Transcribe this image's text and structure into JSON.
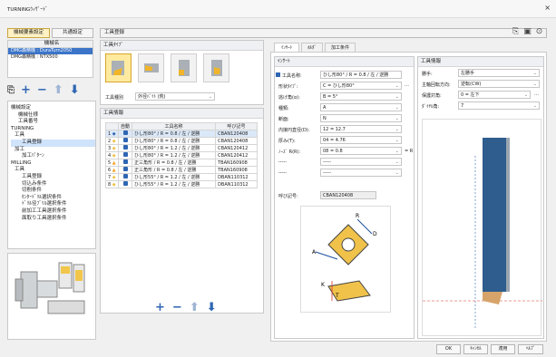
{
  "window": {
    "title": "TURNINGｳｨｻﾞｰﾄﾞ",
    "close": "×"
  },
  "top_tabs": [
    {
      "label": "機械要素設定",
      "selected": true
    },
    {
      "label": "共通設定",
      "selected": false
    }
  ],
  "center_title": "工具登録",
  "machines": {
    "header": "機械名",
    "items": [
      {
        "label": "DMG森精機 : DuraTurn2050",
        "selected": true
      },
      {
        "label": "DMG森精機 : NTX500",
        "selected": false
      }
    ]
  },
  "tree": [
    {
      "label": "機械設定",
      "indent": 0
    },
    {
      "label": "機械仕様",
      "indent": 1
    },
    {
      "label": "工具番号",
      "indent": 1
    },
    {
      "label": "TURNING",
      "indent": 0
    },
    {
      "label": "工具",
      "indent": 1
    },
    {
      "label": "工具登録",
      "indent": 2,
      "selected": true
    },
    {
      "label": "加工",
      "indent": 1
    },
    {
      "label": "加工ﾊﾟﾀｰﾝ",
      "indent": 2
    },
    {
      "label": "MILLING",
      "indent": 0
    },
    {
      "label": "工具",
      "indent": 1
    },
    {
      "label": "工具登録",
      "indent": 2
    },
    {
      "label": "切込み条件",
      "indent": 2
    },
    {
      "label": "切削条件",
      "indent": 2
    },
    {
      "label": "ｾﾝﾀｰﾄﾞﾘﾙ選択条件",
      "indent": 2
    },
    {
      "label": "ﾄﾞﾘﾙ径ﾌﾞﾘﾙ選択条件",
      "indent": 2
    },
    {
      "label": "前加工工具選択条件",
      "indent": 2
    },
    {
      "label": "面取り工具選択条件",
      "indent": 2
    }
  ],
  "tool_type": {
    "header": "工具ﾀｲﾌﾟ",
    "kind_label": "工具種別",
    "kind_value": "外径ﾊﾞｲﾄ (荒)"
  },
  "tool_info": {
    "header": "工具情報",
    "columns": [
      "",
      "自動",
      "工具名称",
      "呼び記号"
    ],
    "rows": [
      {
        "no": "1",
        "flag": "blue",
        "auto": true,
        "name": "ひし形80° / R = 0.8 / 左 / 逆勝",
        "code": "CBAN120408",
        "sel": true
      },
      {
        "no": "2",
        "flag": "yellow",
        "auto": true,
        "name": "ひし形80° / R = 0.8 / 左 / 逆勝",
        "code": "CBAN120408"
      },
      {
        "no": "3",
        "flag": "yellow",
        "auto": true,
        "name": "ひし形80° / R = 1.2 / 左 / 逆勝",
        "code": "CBAN120412"
      },
      {
        "no": "4",
        "flag": "yellow",
        "auto": true,
        "name": "ひし形80° / R = 1.2 / 左 / 逆勝",
        "code": "CBAN120412"
      },
      {
        "no": "5",
        "flag": "warn",
        "auto": true,
        "name": "正三角形 / R = 0.8 / 左 / 逆勝",
        "code": "TBAN160908"
      },
      {
        "no": "6",
        "flag": "warn",
        "auto": true,
        "name": "正三角形 / R = 0.8 / 左 / 逆勝",
        "code": "TBAN160908"
      },
      {
        "no": "7",
        "flag": "yellow",
        "auto": true,
        "name": "ひし形55° / R = 1.2 / 左 / 逆勝",
        "code": "DBAN110312"
      },
      {
        "no": "8",
        "flag": "yellow",
        "auto": true,
        "name": "ひし形55° / R = 1.2 / 左 / 逆勝",
        "code": "DBAN110312"
      }
    ]
  },
  "detail_tabs": [
    "ｲﾝｻｰﾄ",
    "ﾎﾙﾀﾞ",
    "加工条件"
  ],
  "insert": {
    "header": "ｲﾝｻｰﾄ",
    "fields": [
      {
        "label": "工具名称:",
        "value": "ひし形80° / R = 0.8 / 左 / 逆勝",
        "checkbox": true
      },
      {
        "label": "形状ﾀｲﾌﾟ:",
        "value": "C = ひし形80°",
        "dd": true,
        "more": true
      },
      {
        "label": "逃げ角(α):",
        "value": "B = 5°",
        "dd": true
      },
      {
        "label": "種類:",
        "value": "A",
        "dd": true
      },
      {
        "label": "断面:",
        "value": "N",
        "dd": true
      },
      {
        "label": "内接円直径(D):",
        "value": "12 = 12.7",
        "dd": true
      },
      {
        "label": "厚み(T):",
        "value": "04 = 4.76",
        "dd": true
      },
      {
        "label": "ﾉｰｽﾞ R(R):",
        "value": "08 = 0.8",
        "dd": true,
        "suffix": "= R"
      },
      {
        "label": "-----",
        "value": "-----",
        "dd": true
      },
      {
        "label": "-----",
        "value": "-----",
        "dd": true
      }
    ],
    "code_label": "呼び記号:",
    "code_value": "CBAN120408"
  },
  "holder": {
    "header": "工具情報",
    "fields": [
      {
        "label": "勝手:",
        "value": "左勝手"
      },
      {
        "label": "主軸回転方向:",
        "value": "逆転(CW)"
      },
      {
        "label": "保護対角:",
        "value": "0 = 左下",
        "more": true
      },
      {
        "label": "ﾀﾞｲﾔﾙ角:",
        "value": "7"
      }
    ]
  },
  "diagram_labels": {
    "r": "R",
    "d": "D",
    "a": "A",
    "k": "K",
    "t": "T"
  },
  "buttons": {
    "ok": "OK",
    "cancel": "ｷｬﾝｾﾙ",
    "apply": "適用",
    "help": "ﾍﾙﾌﾟ"
  },
  "colors": {
    "accent": "#2f66b3",
    "selection": "#3b74c8",
    "tool_highlight": "#ffeaa0"
  }
}
